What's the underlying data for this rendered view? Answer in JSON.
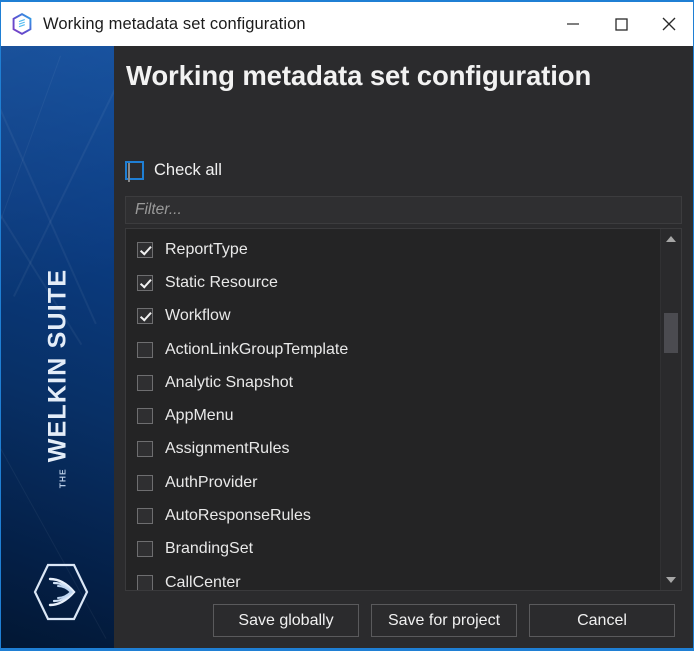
{
  "window": {
    "title": "Working metadata set configuration",
    "icon": "welkin-hexagon-icon",
    "controls": {
      "minimize": "minimize-icon",
      "maximize": "maximize-icon",
      "close": "close-icon"
    }
  },
  "sidebar": {
    "brand_prefix": "THE",
    "brand_name": "WELKIN SUITE",
    "logo": "welkin-hexagon-logo"
  },
  "main": {
    "heading": "Working metadata set configuration",
    "check_all": {
      "label": "Check all",
      "checked": false
    },
    "filter": {
      "placeholder": "Filter...",
      "value": ""
    },
    "list": [
      {
        "label": "ReportType",
        "checked": true
      },
      {
        "label": "Static Resource",
        "checked": true
      },
      {
        "label": "Workflow",
        "checked": true
      },
      {
        "label": "ActionLinkGroupTemplate",
        "checked": false
      },
      {
        "label": "Analytic Snapshot",
        "checked": false
      },
      {
        "label": "AppMenu",
        "checked": false
      },
      {
        "label": "AssignmentRules",
        "checked": false
      },
      {
        "label": "AuthProvider",
        "checked": false
      },
      {
        "label": "AutoResponseRules",
        "checked": false
      },
      {
        "label": "BrandingSet",
        "checked": false
      },
      {
        "label": "CallCenter",
        "checked": false
      }
    ],
    "scrollbar": {
      "up_arrow": "scroll-up-icon",
      "down_arrow": "scroll-down-icon"
    },
    "buttons": {
      "save_globally": "Save globally",
      "save_for_project": "Save for project",
      "cancel": "Cancel"
    }
  },
  "colors": {
    "accent_blue": "#1f7fd4",
    "panel_bg": "#2b2b2d",
    "list_bg": "#242425",
    "sidebar_blue": "#0b3d84",
    "text": "#f0f0f0"
  }
}
